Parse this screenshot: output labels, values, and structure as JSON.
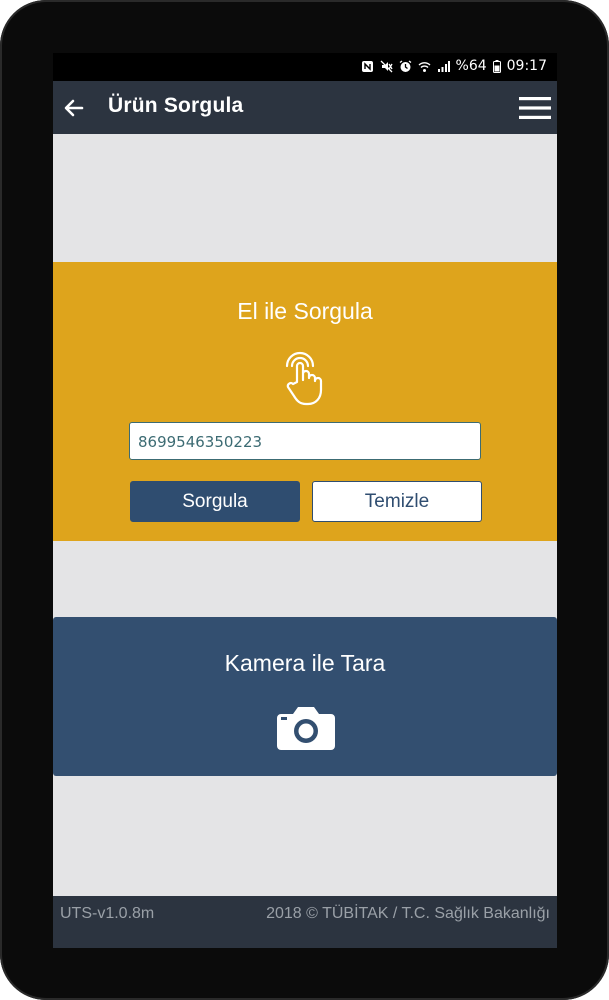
{
  "status_bar": {
    "battery": "%64",
    "time": "09:17",
    "icons": [
      "nfc-icon",
      "mute-icon",
      "alarm-icon",
      "wifi-icon",
      "signal-icon",
      "battery-icon"
    ]
  },
  "app_bar": {
    "title": "Ürün Sorgula",
    "back_icon": "arrow-left-icon",
    "menu_icon": "hamburger-menu-icon"
  },
  "manual_section": {
    "title": "El ile Sorgula",
    "icon": "hand-touch-icon",
    "input_value": "8699546350223",
    "query_button": "Sorgula",
    "clear_button": "Temizle",
    "accent_color": "#dea41c"
  },
  "camera_section": {
    "title": "Kamera ile Tara",
    "icon": "camera-icon",
    "color": "#334f70"
  },
  "footer": {
    "version": "UTS-v1.0.8m",
    "copyright": "2018 © TÜBİTAK / T.C. Sağlık Bakanlığı"
  }
}
